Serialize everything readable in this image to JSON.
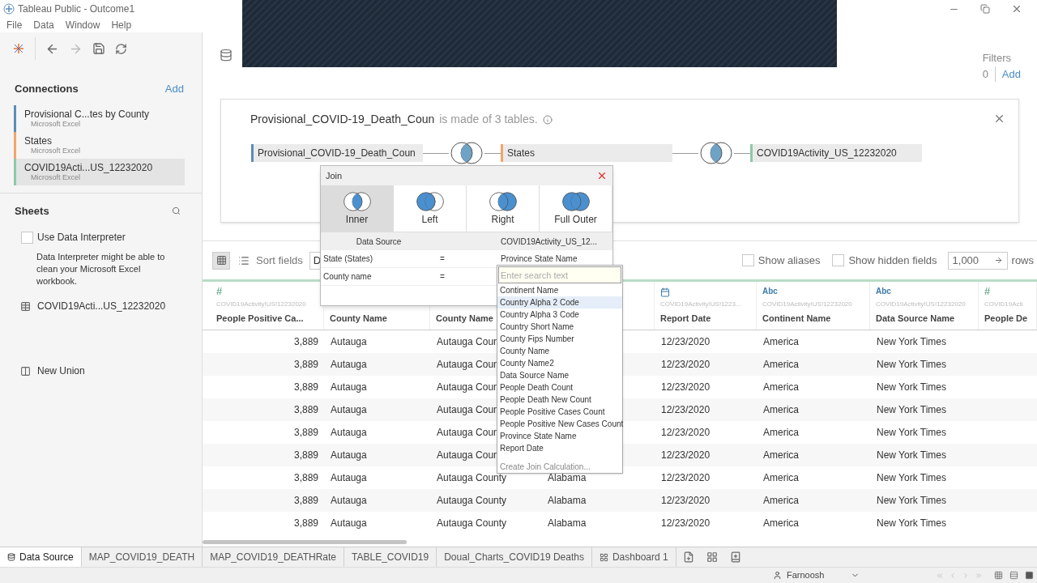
{
  "window": {
    "title": "Tableau Public - Outcome1"
  },
  "menu": [
    "File",
    "Data",
    "Window",
    "Help"
  ],
  "connections": {
    "title": "Connections",
    "add": "Add",
    "items": [
      {
        "name": "Provisional C...tes by County",
        "type": "Microsoft Excel",
        "color": "#5b8db8",
        "selected": false
      },
      {
        "name": "States",
        "type": "Microsoft Excel",
        "color": "#f0a56c",
        "selected": false
      },
      {
        "name": "COVID19Acti...US_12232020",
        "type": "Microsoft Excel",
        "color": "#8fc9a8",
        "selected": true
      }
    ]
  },
  "sheets": {
    "title": "Sheets",
    "interpreter": {
      "label": "Use Data Interpreter",
      "checked": false
    },
    "hint": "Data Interpreter might be able to clean your Microsoft Excel workbook.",
    "items": [
      "COVID19Acti...US_12232020"
    ],
    "new_union": "New Union"
  },
  "filters": {
    "label": "Filters",
    "count": "0",
    "add": "Add"
  },
  "canvas": {
    "title": "Provisional_COVID-19_Death_Coun",
    "title_suffix": "is made of 3 tables.",
    "tables": [
      {
        "name": "Provisional_COVID-19_Death_Coun",
        "color": "#5b8db8"
      },
      {
        "name": "States",
        "color": "#f0a56c"
      },
      {
        "name": "COVID19Activity_US_12232020",
        "color": "#8fc9a8"
      }
    ]
  },
  "join_dialog": {
    "title": "Join",
    "types": [
      {
        "label": "Inner",
        "kind": "inner",
        "selected": true
      },
      {
        "label": "Left",
        "kind": "left",
        "selected": false
      },
      {
        "label": "Right",
        "kind": "right",
        "selected": false
      },
      {
        "label": "Full Outer",
        "kind": "full",
        "selected": false
      }
    ],
    "columns": [
      "Data Source",
      "COVID19Activity_US_12..."
    ],
    "clauses": [
      {
        "left": "State (States)",
        "op": "=",
        "right": "Province State Name"
      },
      {
        "left": "County name",
        "op": "="
      }
    ]
  },
  "field_dropdown": {
    "placeholder": "Enter search text",
    "options": [
      {
        "label": "Continent Name",
        "selected": false
      },
      {
        "label": "Country Alpha 2 Code",
        "selected": true
      },
      {
        "label": "Country Alpha 3 Code",
        "selected": false
      },
      {
        "label": "Country Short Name",
        "selected": false
      },
      {
        "label": "County Fips Number",
        "selected": false
      },
      {
        "label": "County Name",
        "selected": false
      },
      {
        "label": "County Name2",
        "selected": false
      },
      {
        "label": "Data Source Name",
        "selected": false
      },
      {
        "label": "People Death Count",
        "selected": false
      },
      {
        "label": "People Death New Count",
        "selected": false
      },
      {
        "label": "People Positive Cases Count",
        "selected": false
      },
      {
        "label": "People Positive New Cases Count",
        "selected": false
      },
      {
        "label": "Province State Name",
        "selected": false
      },
      {
        "label": "Report Date",
        "selected": false
      }
    ],
    "footer": "Create Join Calculation..."
  },
  "grid_toolbar": {
    "sort_label": "Sort fields",
    "sort_value": "D",
    "show_aliases": {
      "label": "Show aliases",
      "checked": false
    },
    "show_hidden": {
      "label": "Show hidden fields",
      "checked": false
    },
    "rows_value": "1,000",
    "rows_label": "rows"
  },
  "table": {
    "columns": [
      {
        "kind": "number",
        "type_label": "#",
        "source": "COVID19Activity!US!12232020",
        "name": "People Positive Ca..."
      },
      {
        "kind": "hidden",
        "name": "County Name"
      },
      {
        "kind": "hidden",
        "name": "County Name"
      },
      {
        "kind": "hidden"
      },
      {
        "kind": "date",
        "source": "COVID19Activity!US!1223...",
        "name": "Report Date"
      },
      {
        "kind": "string",
        "type_label": "Abc",
        "source": "COVID19Activity!US!12232020",
        "name": "Continent Name"
      },
      {
        "kind": "string",
        "type_label": "Abc",
        "source": "COVID19Activity!US!12232020",
        "name": "Data Source Name"
      },
      {
        "kind": "number",
        "type_label": "#",
        "source": "COVID19Acti",
        "name": "People De"
      }
    ],
    "rows": [
      [
        "3,889",
        "Autauga",
        "Autauga Coun",
        null,
        "12/23/2020",
        "America",
        "New York Times",
        null
      ],
      [
        "3,889",
        "Autauga",
        "Autauga Coun",
        null,
        "12/23/2020",
        "America",
        "New York Times",
        null
      ],
      [
        "3,889",
        "Autauga",
        "Autauga Coun",
        null,
        "12/23/2020",
        "America",
        "New York Times",
        null
      ],
      [
        "3,889",
        "Autauga",
        "Autauga Coun",
        null,
        "12/23/2020",
        "America",
        "New York Times",
        null
      ],
      [
        "3,889",
        "Autauga",
        "Autauga Coun",
        null,
        "12/23/2020",
        "America",
        "New York Times",
        null
      ],
      [
        "3,889",
        "Autauga",
        "Autauga Coun",
        null,
        "12/23/2020",
        "America",
        "New York Times",
        null
      ],
      [
        "3,889",
        "Autauga",
        "Autauga County",
        "Alabama",
        "12/23/2020",
        "America",
        "New York Times",
        null
      ],
      [
        "3,889",
        "Autauga",
        "Autauga County",
        "Alabama",
        "12/23/2020",
        "America",
        "New York Times",
        null
      ],
      [
        "3,889",
        "Autauga",
        "Autauga County",
        "Alabama",
        "12/23/2020",
        "America",
        "New York Times",
        null
      ]
    ]
  },
  "sheet_tabs": [
    {
      "label": "Data Source",
      "kind": "datasource",
      "selected": true
    },
    {
      "label": "MAP_COVID19_DEATH",
      "kind": "sheet",
      "selected": false
    },
    {
      "label": "MAP_COVID19_DEATHRate",
      "kind": "sheet",
      "selected": false
    },
    {
      "label": "TABLE_COVID19",
      "kind": "sheet",
      "selected": false
    },
    {
      "label": "Doual_Charts_COVID19 Deaths",
      "kind": "sheet",
      "selected": false
    },
    {
      "label": "Dashboard 1",
      "kind": "dashboard",
      "selected": false
    }
  ],
  "status": {
    "user": "Farnoosh"
  }
}
